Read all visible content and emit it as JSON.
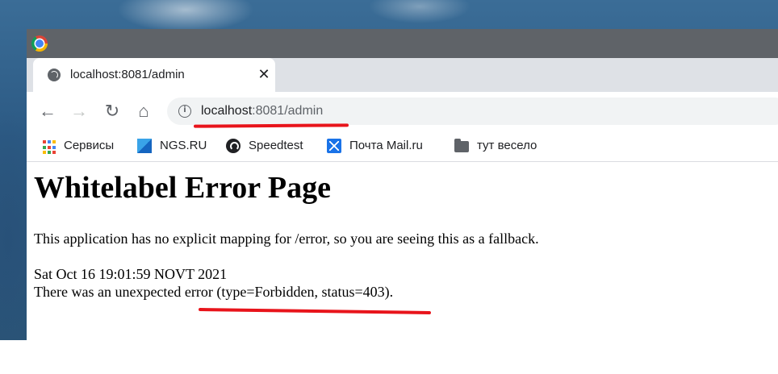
{
  "tab": {
    "title": "localhost:8081/admin",
    "close": "✕"
  },
  "toolbar": {
    "back": "←",
    "forward": "→",
    "reload": "↻",
    "home": "⌂",
    "address": {
      "info": "i",
      "host": "localhost",
      "rest": ":8081/admin"
    }
  },
  "bookmarks": [
    {
      "label": "Сервисы",
      "icon": "apps-grid-icon"
    },
    {
      "label": "NGS.RU",
      "icon": "ngs-icon"
    },
    {
      "label": "Speedtest",
      "icon": "speedtest-icon"
    },
    {
      "label": "Почта Mail.ru",
      "icon": "mail-icon"
    },
    {
      "label": "тут весело",
      "icon": "folder-icon"
    }
  ],
  "page": {
    "heading": "Whitelabel Error Page",
    "message": "This application has no explicit mapping for /error, so you are seeing this as a fallback.",
    "timestamp": "Sat Oct 16 19:01:59 NOVT 2021",
    "error": "There was an unexpected error (type=Forbidden, status=403)."
  },
  "colors": {
    "annotation": "#e8141b",
    "titlebar": "#5f6368",
    "tabstrip": "#dee1e6"
  }
}
